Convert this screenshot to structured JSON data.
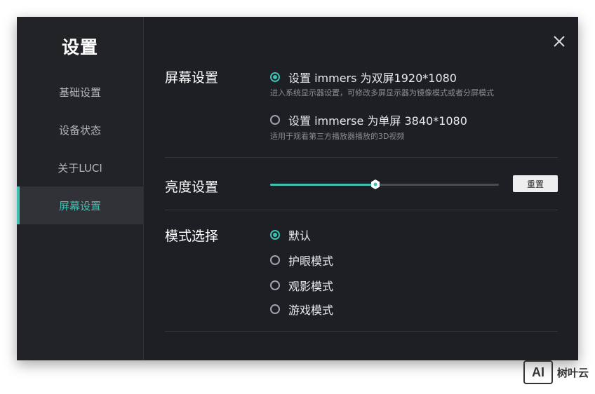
{
  "sidebar": {
    "title": "设置",
    "items": [
      {
        "label": "基础设置",
        "active": false
      },
      {
        "label": "设备状态",
        "active": false
      },
      {
        "label": "关于LUCI",
        "active": false
      },
      {
        "label": "屏幕设置",
        "active": true
      }
    ]
  },
  "screen": {
    "title": "屏幕设置",
    "options": [
      {
        "label": "设置 immers 为双屏1920*1080",
        "desc": "进入系统显示器设置，可修改多屏显示器为镜像模式或者分屏模式",
        "checked": true
      },
      {
        "label": "设置 immerse 为单屏 3840*1080",
        "desc": "适用于观看第三方播放器播放的3D视频",
        "checked": false
      }
    ]
  },
  "brightness": {
    "title": "亮度设置",
    "value_percent": 46,
    "reset_label": "重置"
  },
  "mode": {
    "title": "模式选择",
    "options": [
      {
        "label": "默认",
        "checked": true
      },
      {
        "label": "护眼模式",
        "checked": false
      },
      {
        "label": "观影模式",
        "checked": false
      },
      {
        "label": "游戏模式",
        "checked": false
      }
    ]
  },
  "watermark": {
    "logo": "AI",
    "text": "树叶云"
  },
  "colors": {
    "accent": "#3ec1b1",
    "background": "#1e1f24",
    "sidebar": "#222327"
  }
}
